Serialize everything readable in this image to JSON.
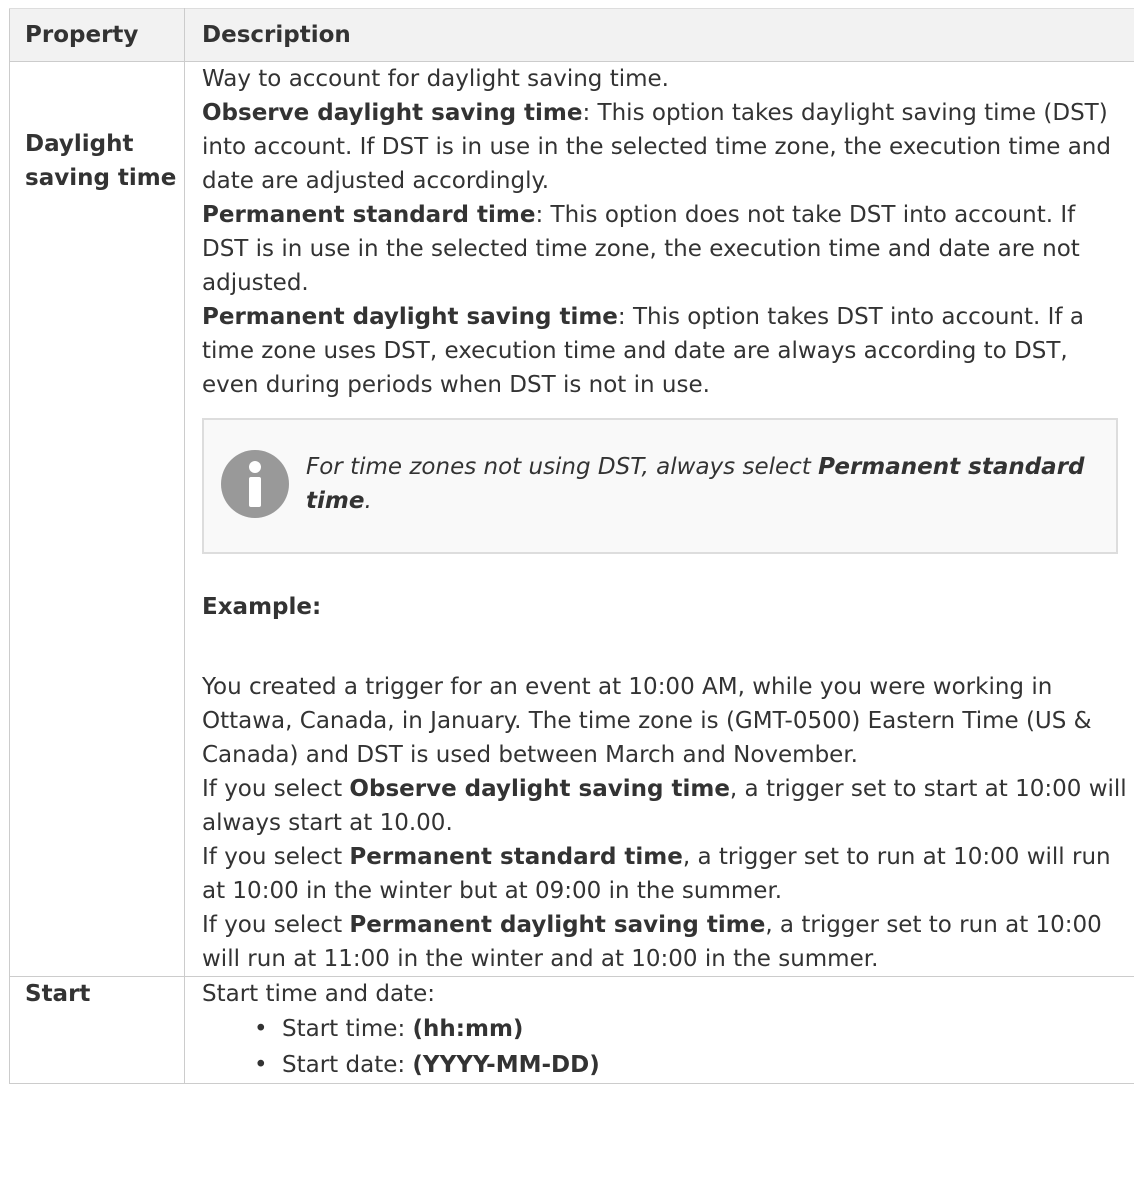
{
  "table": {
    "headers": {
      "property": "Property",
      "description": "Description"
    },
    "rows": [
      {
        "property_line1": "Daylight",
        "property_line2": "saving time",
        "intro": "Way to account for daylight saving time.",
        "options": [
          {
            "term": "Observe daylight saving time",
            "text": ": This option takes daylight saving time (DST) into account. If DST is in use in the selected time zone, the execution time and date are adjusted accordingly."
          },
          {
            "term": "Permanent standard time",
            "text": ": This option does not take DST into account. If DST is in use in the selected time zone, the execution time and date are not adjusted."
          },
          {
            "term": "Permanent daylight saving time",
            "text": ": This option takes DST into account. If a time zone uses DST, execution time and date are always according to DST, even during periods when DST is not in use."
          }
        ],
        "note": {
          "icon": "info-icon",
          "prefix": "For time zones not using DST, always select ",
          "term": "Permanent standard time",
          "suffix": "."
        },
        "example": {
          "heading": "Example:",
          "paragraph": "You created a trigger for an event at 10:00 AM, while you were working in Ottawa, Canada, in January. The time zone is (GMT-0500) Eastern Time (US & Canada) and DST is used between March and November.",
          "cases": [
            {
              "prefix": "If you select ",
              "term": "Observe daylight saving time",
              "suffix": ", a trigger set to start at 10:00 will always start at 10.00."
            },
            {
              "prefix": "If you select ",
              "term": "Permanent standard time",
              "suffix": ", a trigger set to run at 10:00 will run at 10:00 in the winter but at 09:00 in the summer."
            },
            {
              "prefix": "If you select ",
              "term": "Permanent daylight saving time",
              "suffix": ", a trigger set to run at 10:00 will run at 11:00 in the winter and at 10:00 in the summer."
            }
          ]
        }
      },
      {
        "property": "Start",
        "intro": "Start time and date:",
        "items": [
          {
            "label": "Start time: ",
            "value": "(hh:mm)"
          },
          {
            "label": "Start date: ",
            "value": "(YYYY-MM-DD)"
          }
        ]
      }
    ]
  },
  "colors": {
    "text": "#333333",
    "header_bg": "#f2f2f2",
    "border": "#cccccc",
    "note_bg": "#f9f9f9",
    "note_border": "#dddddd",
    "icon": "#999999"
  }
}
